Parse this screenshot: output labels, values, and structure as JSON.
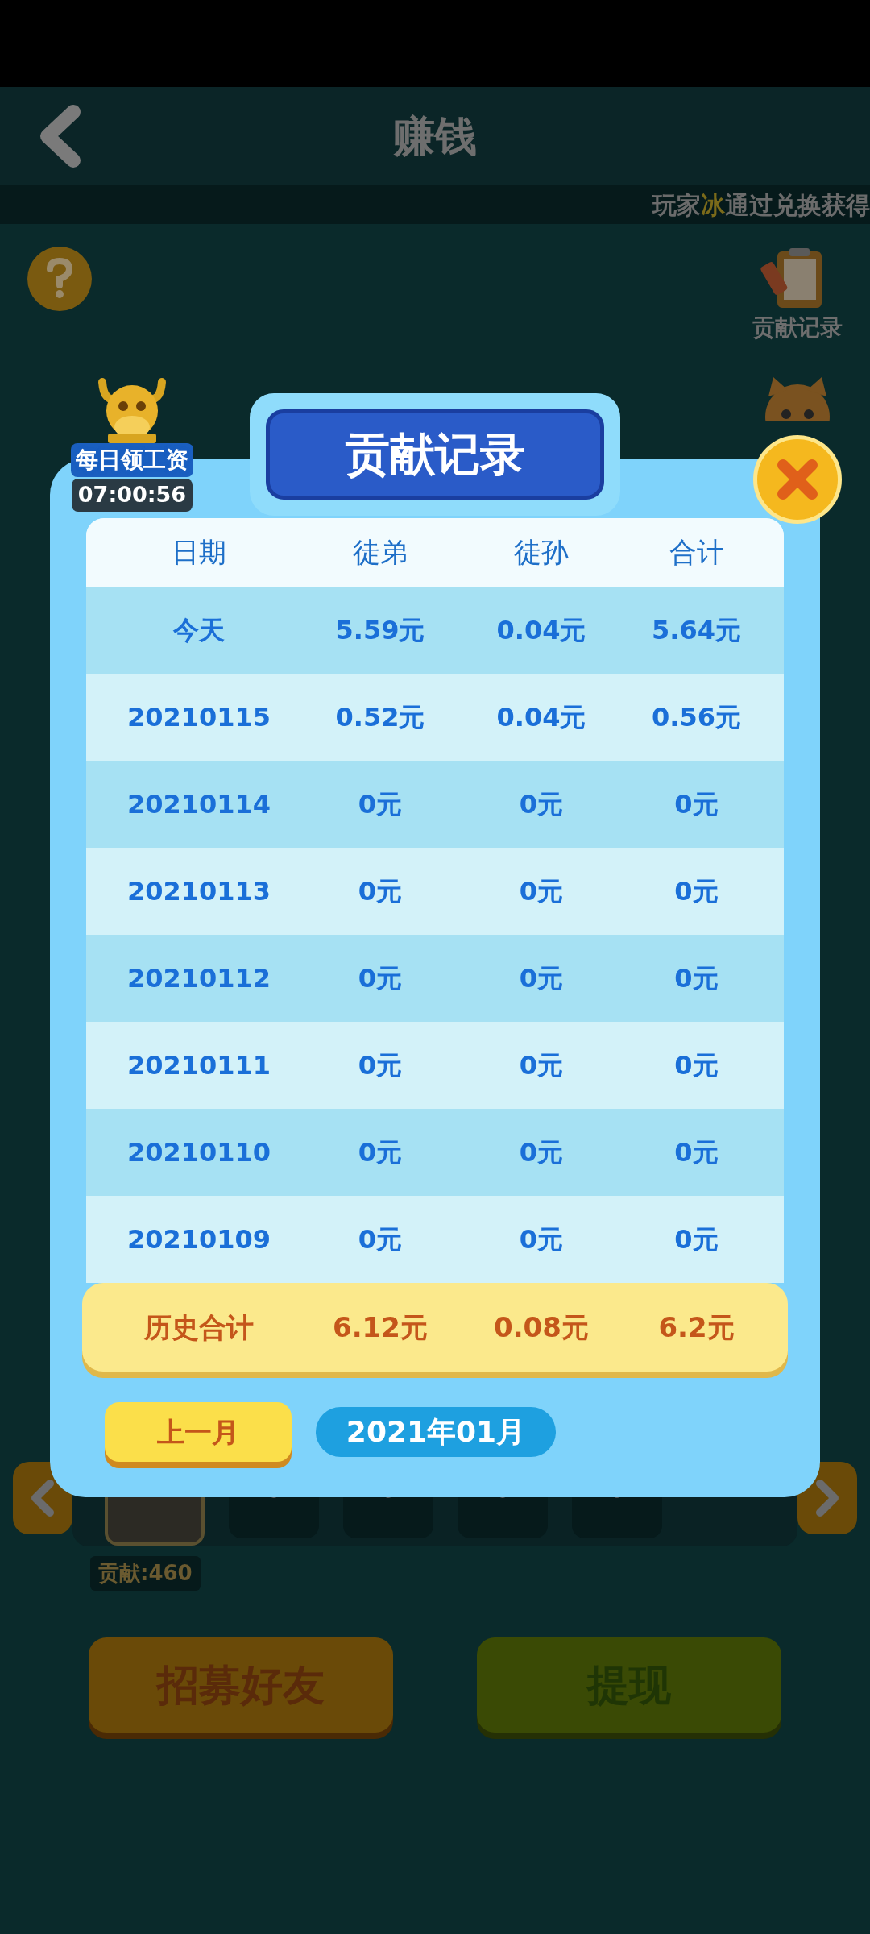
{
  "header": {
    "title": "赚钱"
  },
  "marquee": [
    {
      "text": "玩家",
      "highlight": false
    },
    {
      "text": "冰",
      "highlight": true
    },
    {
      "text": "通过兑换获得",
      "highlight": false
    }
  ],
  "side_icons": {
    "record_label": "贡献记录"
  },
  "daily_wage": {
    "label": "每日领工资",
    "timer": "07:00:56"
  },
  "friends": {
    "slots": [
      {
        "kind": "photo"
      },
      {
        "kind": "empty"
      },
      {
        "kind": "empty"
      },
      {
        "kind": "empty"
      },
      {
        "kind": "empty"
      }
    ],
    "contribution": "贡献:460"
  },
  "actions": [
    {
      "label": "招募好友",
      "kind": "orange"
    },
    {
      "label": "提现",
      "kind": "green"
    }
  ],
  "dialog": {
    "title": "贡献记录",
    "columns": [
      "日期",
      "徒弟",
      "徒孙",
      "合计"
    ],
    "rows": [
      [
        "今天",
        "5.59元",
        "0.04元",
        "5.64元"
      ],
      [
        "20210115",
        "0.52元",
        "0.04元",
        "0.56元"
      ],
      [
        "20210114",
        "0元",
        "0元",
        "0元"
      ],
      [
        "20210113",
        "0元",
        "0元",
        "0元"
      ],
      [
        "20210112",
        "0元",
        "0元",
        "0元"
      ],
      [
        "20210111",
        "0元",
        "0元",
        "0元"
      ],
      [
        "20210110",
        "0元",
        "0元",
        "0元"
      ],
      [
        "20210109",
        "0元",
        "0元",
        "0元"
      ]
    ],
    "total": [
      "历史合计",
      "6.12元",
      "0.08元",
      "6.2元"
    ],
    "prev_button": "上一月",
    "month": "2021年01月"
  }
}
